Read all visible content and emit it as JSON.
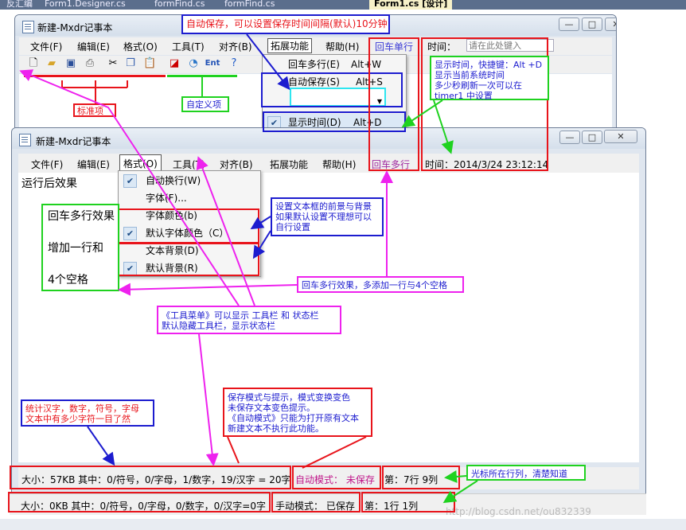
{
  "ide_tabs": [
    "反汇编",
    "Form1.Designer.cs",
    "formFind.cs",
    "formFind.cs",
    "Form1.cs [设计]"
  ],
  "window_top": {
    "title": "新建-Mxdr记事本",
    "menus": [
      "文件(F)",
      "编辑(E)",
      "格式(O)",
      "工具(T)",
      "对齐(B)",
      "拓展功能",
      "帮助(H)",
      "回车单行"
    ],
    "time_label": "时间：",
    "time_input_placeholder": "请在此处键入",
    "ext_menu": {
      "items": [
        {
          "label": "回车多行(E)",
          "shortcut": "Alt+W",
          "checked": false
        },
        {
          "label": "自动保存(S)",
          "shortcut": "Alt+S",
          "checked": false
        },
        {
          "label": "显示时间(D)",
          "shortcut": "Alt+D",
          "checked": true
        }
      ]
    }
  },
  "window_bottom": {
    "title": "新建-Mxdr记事本",
    "menus": [
      "文件(F)",
      "编辑(E)",
      "格式(O)",
      "工具(T)",
      "对齐(B)",
      "拓展功能",
      "帮助(H)",
      "回车多行"
    ],
    "time_text": "时间：2014/3/24 23:12:14",
    "editor_lines": [
      "运行后效果",
      "回车多行效果",
      "增加一行和",
      "4个空格"
    ],
    "format_menu": {
      "items": [
        {
          "label": "自动换行(W)",
          "checked": true
        },
        {
          "label": "字体(F)...",
          "checked": false
        },
        {
          "label": "字体颜色(b)",
          "checked": false
        },
        {
          "label": "默认字体颜色（C）",
          "checked": true
        },
        {
          "label": "文本背景(D)",
          "checked": false
        },
        {
          "label": "默认背景(R)",
          "checked": true
        }
      ]
    },
    "status": {
      "counts": "大小：57KB  其中：0/符号，0/字母，1/数字，19/汉字 = 20字",
      "mode": "自动模式：  未保存",
      "position": "第：7行 9列"
    }
  },
  "window_third_status": {
    "counts": "大小：0KB  其中：0/符号，0/字母，0/数字，0/汉字=0字",
    "mode": "手动模式：  已保存",
    "position": "第：1行 1列"
  },
  "annotations": {
    "autosave": "自动保存，可以设置保存时间间隔(默认)10分钟",
    "standard": "标准项",
    "custom": "自定义项",
    "showtime": "显示时间，快捷键：Alt +D\n显示当前系统时间\n多少秒刷新一次可以在\ntimer1 中设置",
    "colors": "设置文本框的前景与背景\n如果默认设置不理想可以\n自行设置",
    "multiline": "回车多行效果，多添加一行与4个空格",
    "toolmenu": "《工具菜单》可以显示 工具栏 和 状态栏\n默认隐藏工具栏，显示状态栏",
    "stats": "统计汉字，数字，符号，字母\n文本中有多少字符一目了然",
    "savemode": "保存模式与提示，模式变换变色\n未保存文本变色提示。\n《自动模式》只能为打开原有文本\n新建文本不执行此功能。",
    "cursor": "光标所在行列，清楚知道",
    "watermark": "http://blog.csdn.net/ou832339"
  },
  "colors": {
    "red": "#e8141b",
    "blue": "#1c1ccf",
    "green": "#1fd21f",
    "magenta": "#ee22ee",
    "cyan": "#2ee6f0"
  }
}
